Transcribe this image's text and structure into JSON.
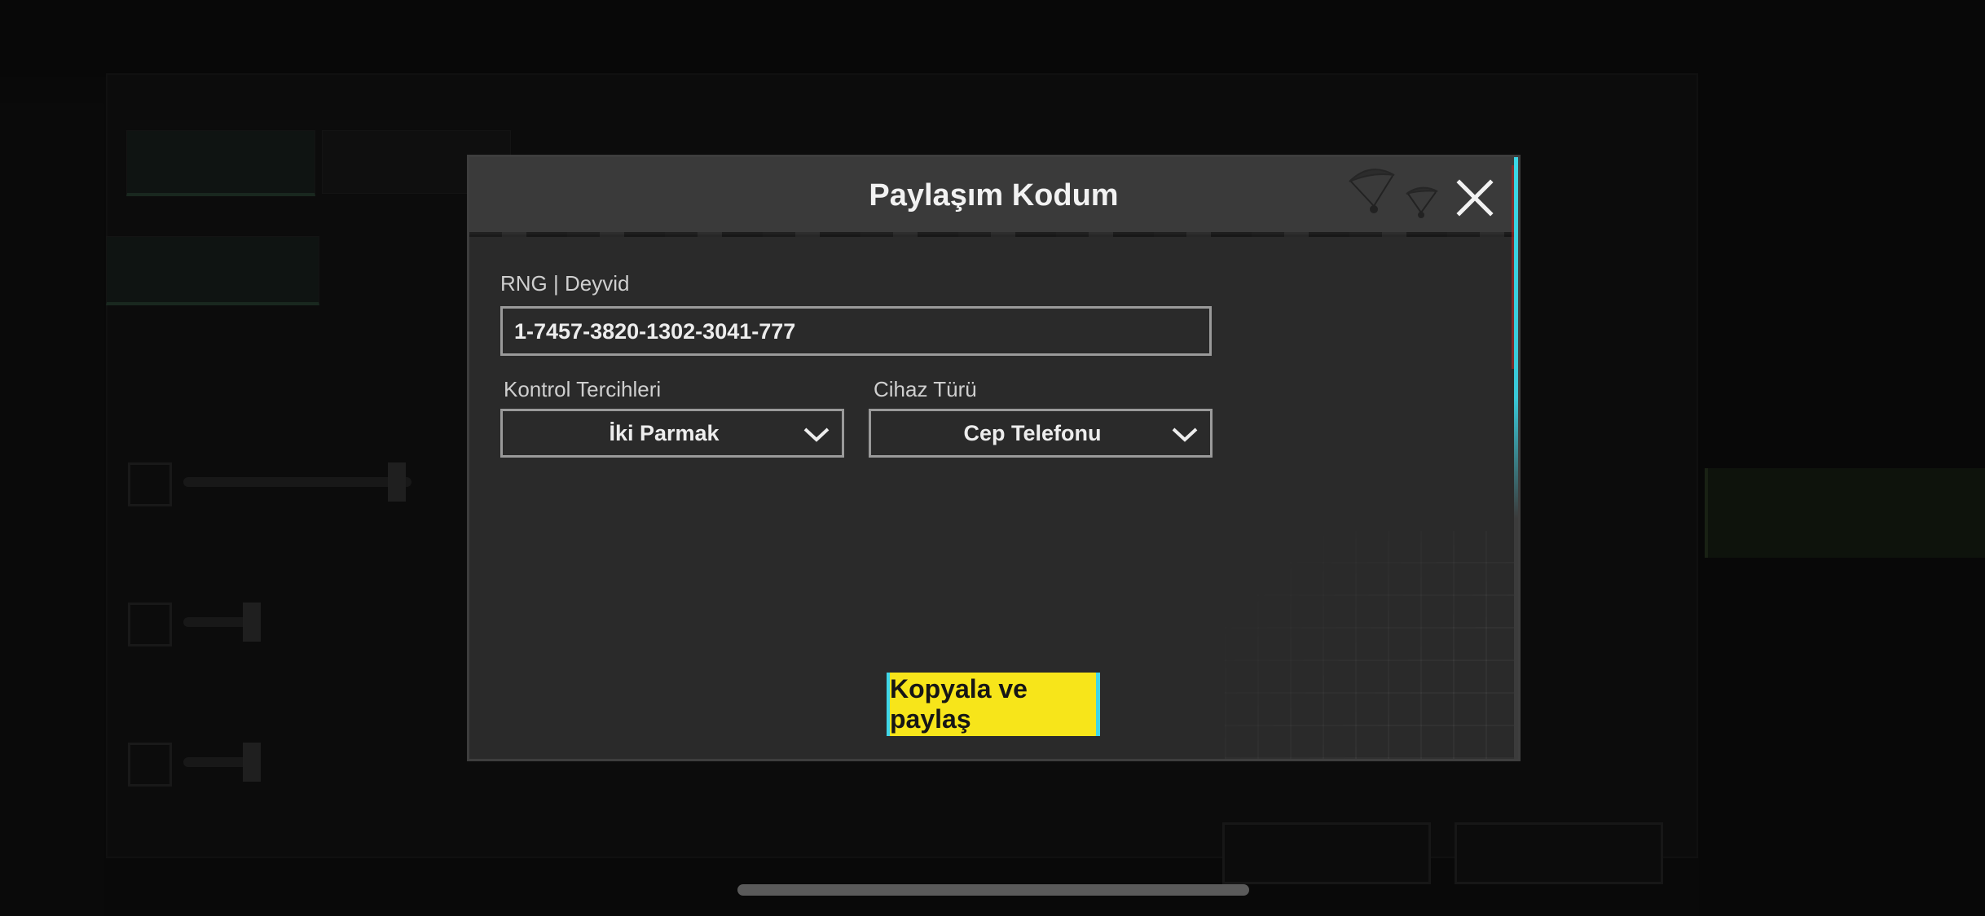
{
  "dialog": {
    "title": "Paylaşım Kodum",
    "player_line": "RNG | Deyvid",
    "share_code": "1-7457-3820-1302-3041-777",
    "control_pref_label": "Kontrol Tercihleri",
    "control_pref_value": "İki Parmak",
    "device_type_label": "Cihaz Türü",
    "device_type_value": "Cep Telefonu",
    "share_button_label": "Kopyala ve paylaş"
  },
  "colors": {
    "share_button": "#f7e51a",
    "accent_cyan": "#3bd6e6",
    "dialog_bg": "#2a2a2a"
  },
  "icons": {
    "close": "close-icon",
    "dropdown": "chevron-down-icon",
    "decoration": "parachute-icon"
  }
}
